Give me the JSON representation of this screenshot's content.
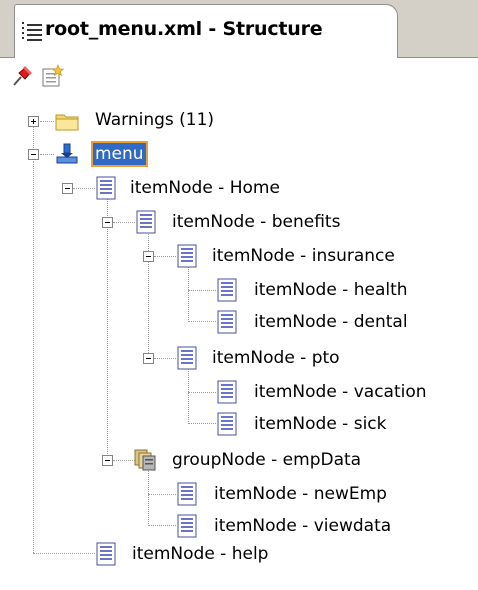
{
  "tab": {
    "title": "root_menu.xml - Structure",
    "icon": "structure-icon"
  },
  "toolbar": {
    "buttons": [
      {
        "name": "pin-icon",
        "tooltip": ""
      },
      {
        "name": "new-node-icon",
        "tooltip": ""
      }
    ]
  },
  "tree": {
    "warnings": {
      "label": "Warnings (11)",
      "expanded": false
    },
    "root": {
      "label": "menu",
      "selected": true
    },
    "nodes": [
      {
        "label": "itemNode - Home"
      },
      {
        "label": "itemNode - benefits"
      },
      {
        "label": "itemNode - insurance"
      },
      {
        "label": "itemNode - health"
      },
      {
        "label": "itemNode - dental"
      },
      {
        "label": "itemNode - pto"
      },
      {
        "label": "itemNode - vacation"
      },
      {
        "label": "itemNode - sick"
      },
      {
        "label": "groupNode - empData"
      },
      {
        "label": "itemNode - newEmp"
      },
      {
        "label": "itemNode - viewdata"
      },
      {
        "label": "itemNode - help"
      }
    ]
  },
  "colors": {
    "selection_bg": "#316ac5",
    "selection_border": "#f0a030",
    "folder": "#f5d76e",
    "node_icon": "#6b74c8",
    "tab_strip": "#d4d0c8"
  }
}
